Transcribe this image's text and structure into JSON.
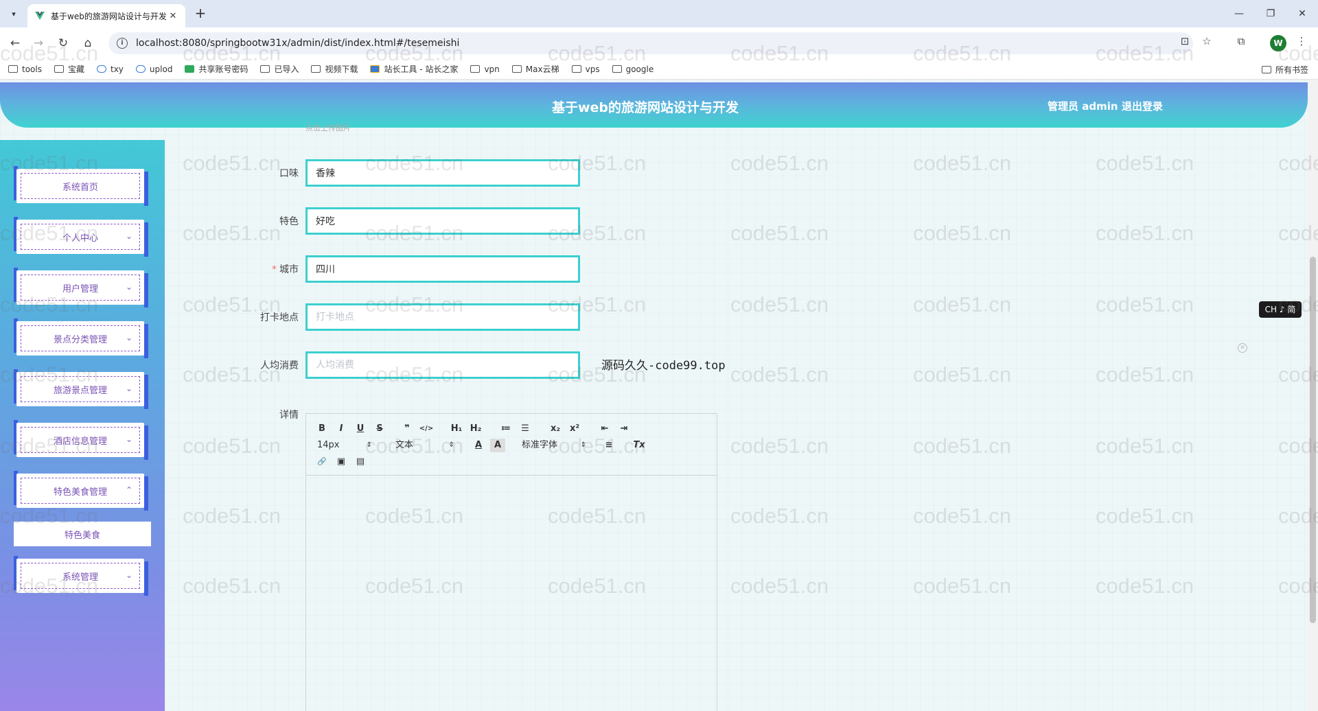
{
  "browser": {
    "tab_title": "基于web的旅游网站设计与开发",
    "tab_close": "✕",
    "new_tab": "+",
    "url": "localhost:8080/springbootw31x/admin/dist/index.html#/tesemeishi",
    "profile_initial": "W",
    "bookmarks": [
      "tools",
      "宝藏",
      "txy",
      "uplod",
      "共享账号密码",
      "已导入",
      "视频下载",
      "站长工具 - 站长之家",
      "vpn",
      "Max云梯",
      "vps",
      "google"
    ],
    "bookmarks_all": "所有书签"
  },
  "header": {
    "title": "基于web的旅游网站设计与开发",
    "user": "管理员 admin",
    "logout": "退出登录"
  },
  "sidebar": {
    "items": [
      {
        "label": "系统首页"
      },
      {
        "label": "个人中心"
      },
      {
        "label": "用户管理"
      },
      {
        "label": "景点分类管理"
      },
      {
        "label": "旅游景点管理"
      },
      {
        "label": "酒店信息管理"
      },
      {
        "label": "特色美食管理"
      },
      {
        "label": "特色美食"
      },
      {
        "label": "系统管理"
      }
    ]
  },
  "form": {
    "caption": "点击上传图片",
    "fields": [
      {
        "label": "口味",
        "value": "香辣",
        "placeholder": "口味",
        "required": false
      },
      {
        "label": "特色",
        "value": "好吃",
        "placeholder": "特色",
        "required": false
      },
      {
        "label": "城市",
        "value": "四川",
        "placeholder": "城市",
        "required": true
      },
      {
        "label": "打卡地点",
        "value": "",
        "placeholder": "打卡地点",
        "required": false
      },
      {
        "label": "人均消费",
        "value": "",
        "placeholder": "人均消费",
        "required": false
      }
    ],
    "required_mark": "*",
    "detail_label": "详情",
    "side_note": "源码久久-code99.top"
  },
  "editor": {
    "buttons": {
      "bold": "B",
      "italic": "I",
      "underline": "U",
      "strike": "S",
      "quote": "❞",
      "code": "</>",
      "h1": "H₁",
      "h2": "H₂",
      "ordered_list": "≔",
      "bullet_list": "☰",
      "sub": "x₂",
      "sup": "x²",
      "outdent": "⇤",
      "indent": "⇥",
      "font_color": "A",
      "bg_color": "A",
      "align": "≡",
      "clean": "Tx",
      "link": "🔗",
      "image": "▣",
      "video": "▤"
    },
    "size_value": "14px",
    "header_value": "文本",
    "font_value": "标准字体",
    "select_arrow": "⇕"
  },
  "ime": {
    "label": "CH ♪ 简"
  },
  "watermark": "code51.cn",
  "colors": {
    "accent": "#3ccfcf",
    "menu_text": "#7a52b5",
    "required": "#f56c6c"
  }
}
